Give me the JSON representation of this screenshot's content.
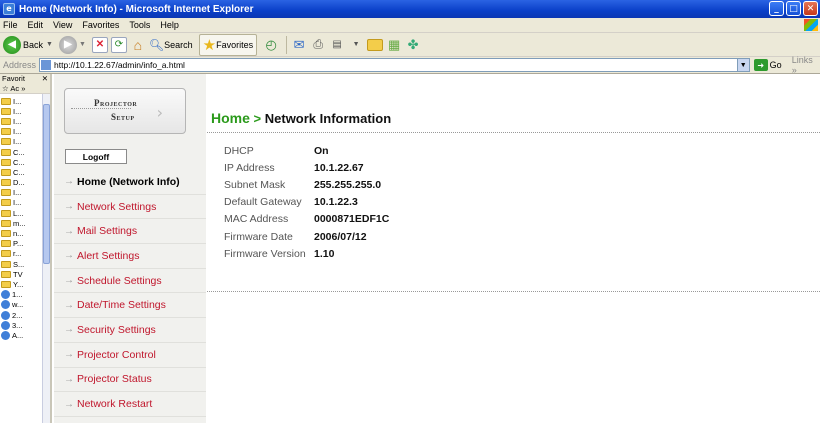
{
  "window": {
    "title": "Home (Network Info) - Microsoft Internet Explorer"
  },
  "menu": [
    "File",
    "Edit",
    "View",
    "Favorites",
    "Tools",
    "Help"
  ],
  "toolbar": {
    "back_label": "Back",
    "search_label": "Search",
    "favorites_label": "Favorites"
  },
  "address": {
    "label": "Address",
    "url": "http://10.1.22.67/admin/info_a.html",
    "go_label": "Go",
    "links_label": "Links"
  },
  "favorites": {
    "header": "Favorit",
    "add_label": "Ac",
    "items": [
      {
        "type": "folder",
        "label": "I..."
      },
      {
        "type": "folder",
        "label": "I..."
      },
      {
        "type": "folder",
        "label": "I..."
      },
      {
        "type": "folder",
        "label": "I..."
      },
      {
        "type": "folder",
        "label": "I..."
      },
      {
        "type": "folder",
        "label": "C..."
      },
      {
        "type": "folder",
        "label": "C..."
      },
      {
        "type": "folder",
        "label": "C..."
      },
      {
        "type": "folder",
        "label": "D..."
      },
      {
        "type": "folder",
        "label": "I..."
      },
      {
        "type": "folder",
        "label": "I..."
      },
      {
        "type": "folder",
        "label": "L..."
      },
      {
        "type": "folder",
        "label": "m..."
      },
      {
        "type": "folder",
        "label": "n..."
      },
      {
        "type": "folder",
        "label": "P..."
      },
      {
        "type": "folder",
        "label": "r..."
      },
      {
        "type": "folder",
        "label": "S..."
      },
      {
        "type": "folder",
        "label": "TV"
      },
      {
        "type": "folder",
        "label": "Y..."
      },
      {
        "type": "ie",
        "label": "1..."
      },
      {
        "type": "ie",
        "label": "w..."
      },
      {
        "type": "ie",
        "label": "2..."
      },
      {
        "type": "ie",
        "label": "3..."
      },
      {
        "type": "ie",
        "label": "A..."
      }
    ]
  },
  "sidebar": {
    "logo_line1": "Projector",
    "logo_line2": "Setup",
    "logoff_label": "Logoff",
    "nav": [
      {
        "label": "Home (Network Info)",
        "active": true
      },
      {
        "label": "Network Settings",
        "active": false
      },
      {
        "label": "Mail Settings",
        "active": false
      },
      {
        "label": "Alert Settings",
        "active": false
      },
      {
        "label": "Schedule Settings",
        "active": false
      },
      {
        "label": "Date/Time Settings",
        "active": false
      },
      {
        "label": "Security Settings",
        "active": false
      },
      {
        "label": "Projector Control",
        "active": false
      },
      {
        "label": "Projector Status",
        "active": false
      },
      {
        "label": "Network Restart",
        "active": false
      }
    ]
  },
  "main": {
    "breadcrumb_home": "Home",
    "breadcrumb_sep": ">",
    "breadcrumb_current": "Network Information",
    "info": [
      {
        "key": "DHCP",
        "value": "On"
      },
      {
        "key": "IP Address",
        "value": "10.1.22.67"
      },
      {
        "key": "Subnet Mask",
        "value": "255.255.255.0"
      },
      {
        "key": "Default Gateway",
        "value": "10.1.22.3"
      },
      {
        "key": "MAC Address",
        "value": "0000871EDF1C"
      },
      {
        "key": "Firmware Date",
        "value": "2006/07/12"
      },
      {
        "key": "Firmware Version",
        "value": "1.10"
      }
    ]
  }
}
